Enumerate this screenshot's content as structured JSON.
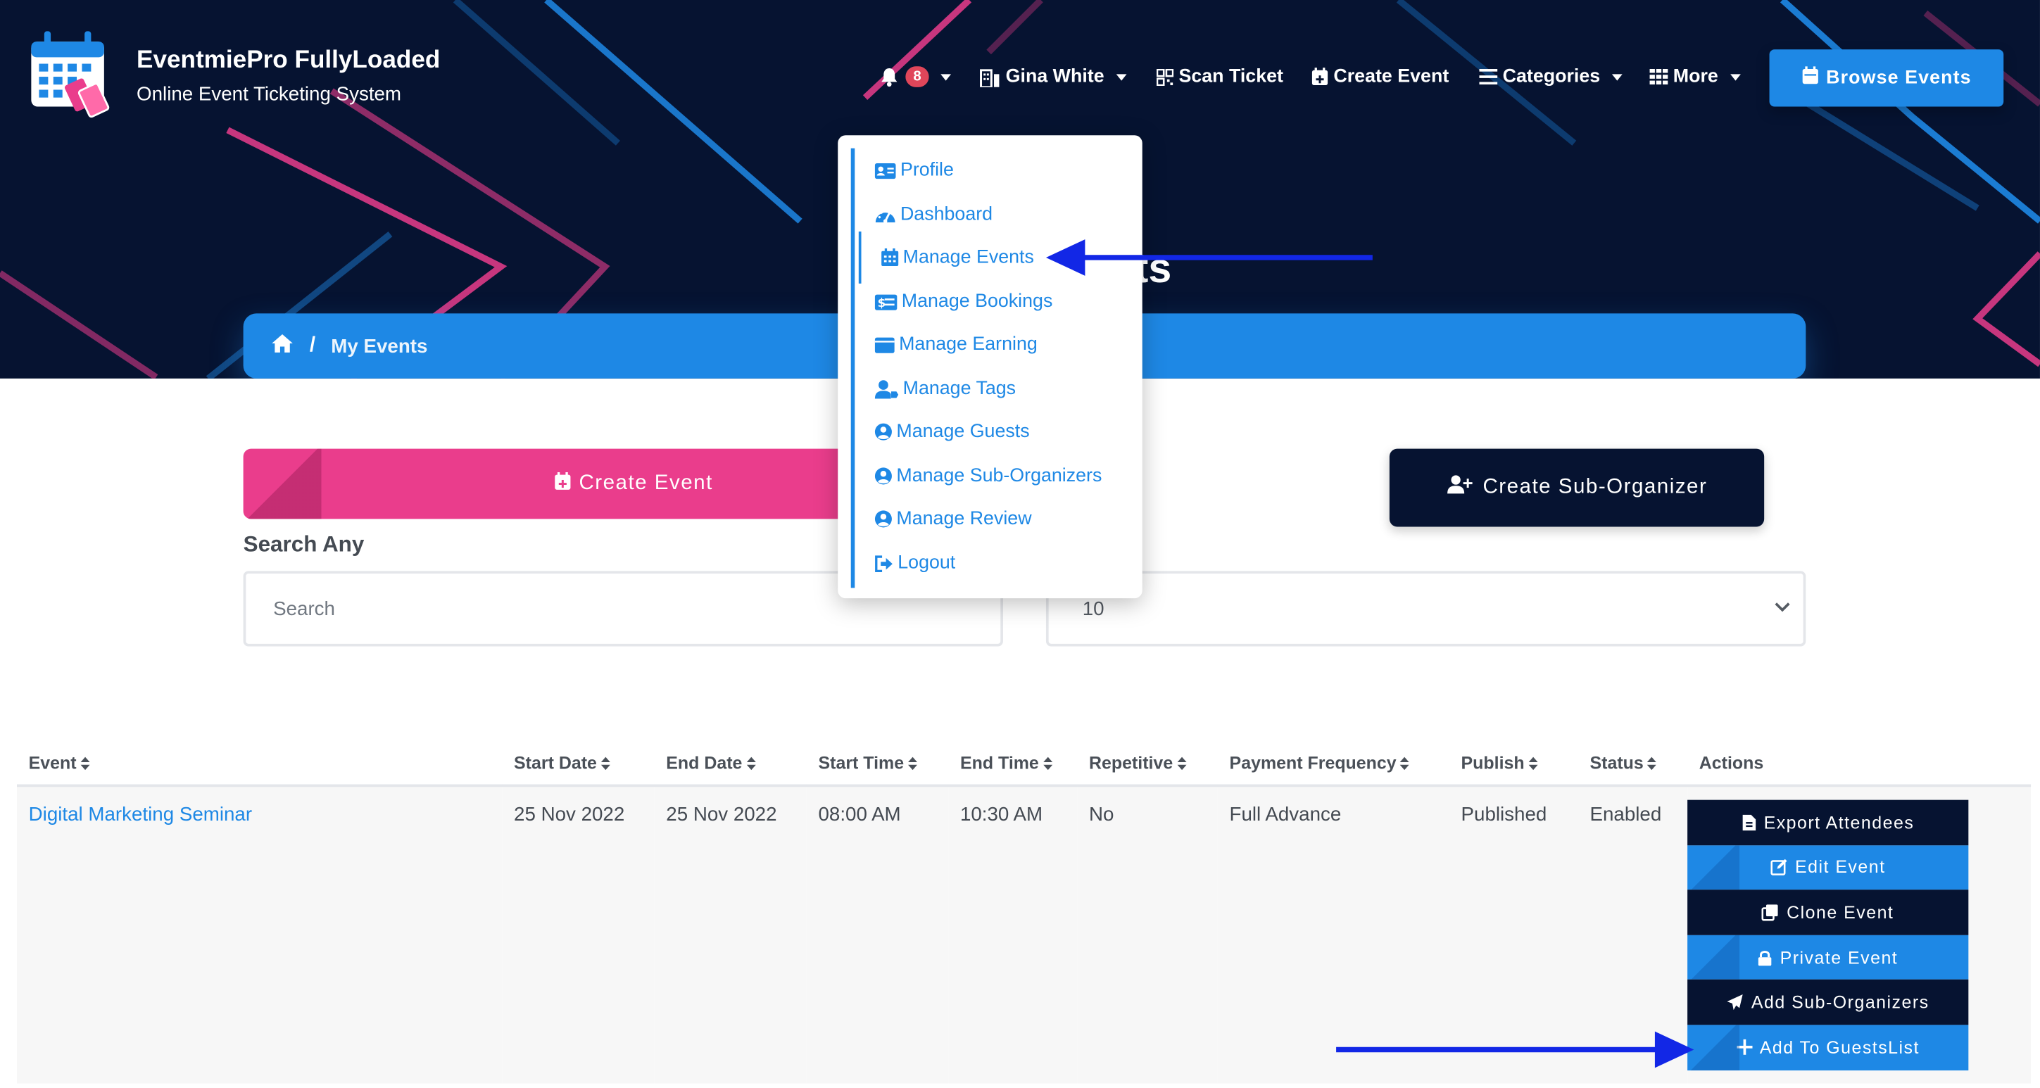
{
  "brand": {
    "name": "EventmiePro FullyLoaded",
    "tagline": "Online Event Ticketing System"
  },
  "nav": {
    "notification_count": "8",
    "user": "Gina White",
    "scan_ticket": "Scan Ticket",
    "create_event": "Create Event",
    "categories": "Categories",
    "more": "More",
    "browse_events": "Browse Events"
  },
  "hero": {
    "title_tail": "ts"
  },
  "breadcrumb": {
    "current": "My Events"
  },
  "user_menu": {
    "items": [
      {
        "label": "Profile",
        "icon": "id-card-icon"
      },
      {
        "label": "Dashboard",
        "icon": "dashboard-gauge-icon"
      },
      {
        "label": "Manage Events",
        "icon": "calendar-icon"
      },
      {
        "label": "Manage Bookings",
        "icon": "money-bill-icon"
      },
      {
        "label": "Manage Earning",
        "icon": "wallet-icon"
      },
      {
        "label": "Manage Tags",
        "icon": "user-tag-icon"
      },
      {
        "label": "Manage Guests",
        "icon": "user-circle-icon"
      },
      {
        "label": "Manage Sub-Organizers",
        "icon": "user-circle-icon"
      },
      {
        "label": "Manage Review",
        "icon": "user-circle-icon"
      },
      {
        "label": "Logout",
        "icon": "sign-out-icon"
      }
    ],
    "active": "Manage Events"
  },
  "toolbar": {
    "create_event": "Create Event",
    "create_sub_organizer": "Create Sub-Organizer"
  },
  "search": {
    "label": "Search Any",
    "placeholder": "Search",
    "per_page": "10"
  },
  "table": {
    "headers": [
      "Event",
      "Start Date",
      "End Date",
      "Start Time",
      "End Time",
      "Repetitive",
      "Payment Frequency",
      "Publish",
      "Status",
      "Actions"
    ],
    "rows": [
      {
        "event": "Digital Marketing Seminar",
        "start_date": "25 Nov 2022",
        "end_date": "25 Nov 2022",
        "start_time": "08:00 AM",
        "end_time": "10:30 AM",
        "repetitive": "No",
        "payment_frequency": "Full Advance",
        "publish": "Published",
        "status": "Enabled",
        "actions": [
          "Export Attendees",
          "Edit Event",
          "Clone Event",
          "Private Event",
          "Add Sub-Organizers",
          "Add To GuestsList"
        ]
      }
    ]
  },
  "colors": {
    "navy": "#061331",
    "blue": "#1e88e5",
    "pink": "#ea3d8c",
    "annotation_arrow": "#1227e6"
  }
}
